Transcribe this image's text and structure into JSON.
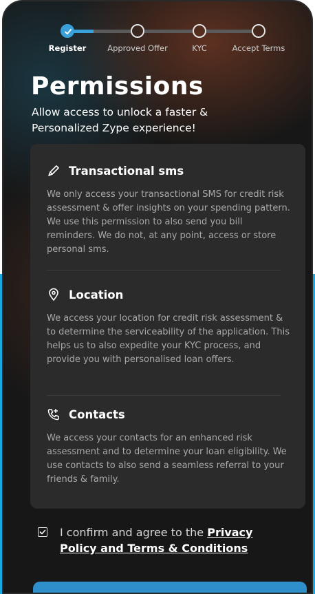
{
  "stepper": {
    "steps": [
      {
        "label": "Register",
        "status": "done"
      },
      {
        "label": "Approved Offer",
        "status": "pending"
      },
      {
        "label": "KYC",
        "status": "pending"
      },
      {
        "label": "Accept Terms",
        "status": "pending"
      }
    ]
  },
  "page": {
    "title": "Permissions",
    "subtitle": "Allow access to unlock a faster & Personalized Zype experience!"
  },
  "permissions": [
    {
      "icon": "message-icon",
      "title": "Transactional sms",
      "description": "We only access your transactional SMS for credit risk assessment & offer insights on your spending pattern. We use this permission to also send you bill reminders. We do not, at any point, access or store personal sms."
    },
    {
      "icon": "location-pin-icon",
      "title": "Location",
      "description": "We access your location for credit risk assessment & to determine the serviceability of the application. This helps us to also expedite your KYC process, and provide you with personalised loan offers."
    },
    {
      "icon": "phone-contacts-icon",
      "title": "Contacts",
      "description": "We access your contacts for an enhanced risk assessment and to determine your loan eligibility. We use contacts to also send a seamless referral to your friends & family."
    }
  ],
  "consent": {
    "checked": true,
    "text": "I confirm and agree to the ",
    "link": "Privacy Policy and Terms & Conditions"
  },
  "colors": {
    "accent": "#3aa0d9",
    "background": "#171717",
    "card": "#2b2b2b"
  }
}
